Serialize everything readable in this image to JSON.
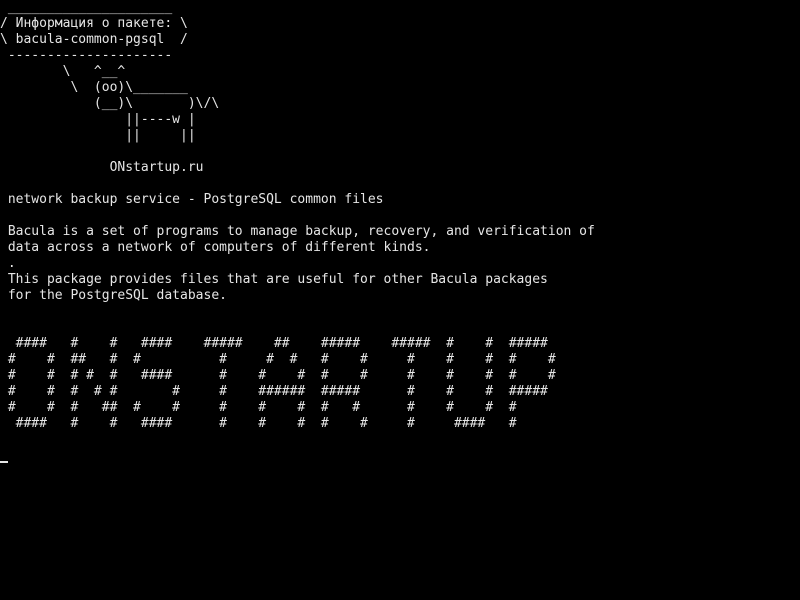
{
  "terminal": {
    "cowsay": {
      "bubble": [
        " _____________________",
        "/ Информация о пакете: \\",
        "\\ bacula-common-pgsql  /",
        " ---------------------"
      ],
      "cow": [
        "        \\   ^__^",
        "         \\  (oo)\\_______",
        "            (__)\\       )\\/\\",
        "                ||----w |",
        "                ||     ||"
      ],
      "credit": "              ONstartup.ru"
    },
    "summary": " network backup service - PostgreSQL common files",
    "description": [
      " Bacula is a set of programs to manage backup, recovery, and verification of",
      " data across a network of computers of different kinds.",
      " .",
      " This package provides files that are useful for other Bacula packages",
      " for the PostgreSQL database."
    ],
    "banner": [
      "  ####   #    #   ####    #####    ##    #####    #####  #    #  #####",
      " #    #  ##   #  #          #     #  #   #    #     #    #    #  #    #",
      " #    #  # #  #   ####      #    #    #  #    #     #    #    #  #    #",
      " #    #  #  # #       #     #    ######  #####      #    #    #  #####",
      " #    #  #   ##  #    #     #    #    #  #   #      #    #    #  #",
      "  ####   #    #   ####      #    #    #  #    #     #     ####   #"
    ],
    "text_color": "#e6e6e6",
    "background_color": "#000000"
  }
}
